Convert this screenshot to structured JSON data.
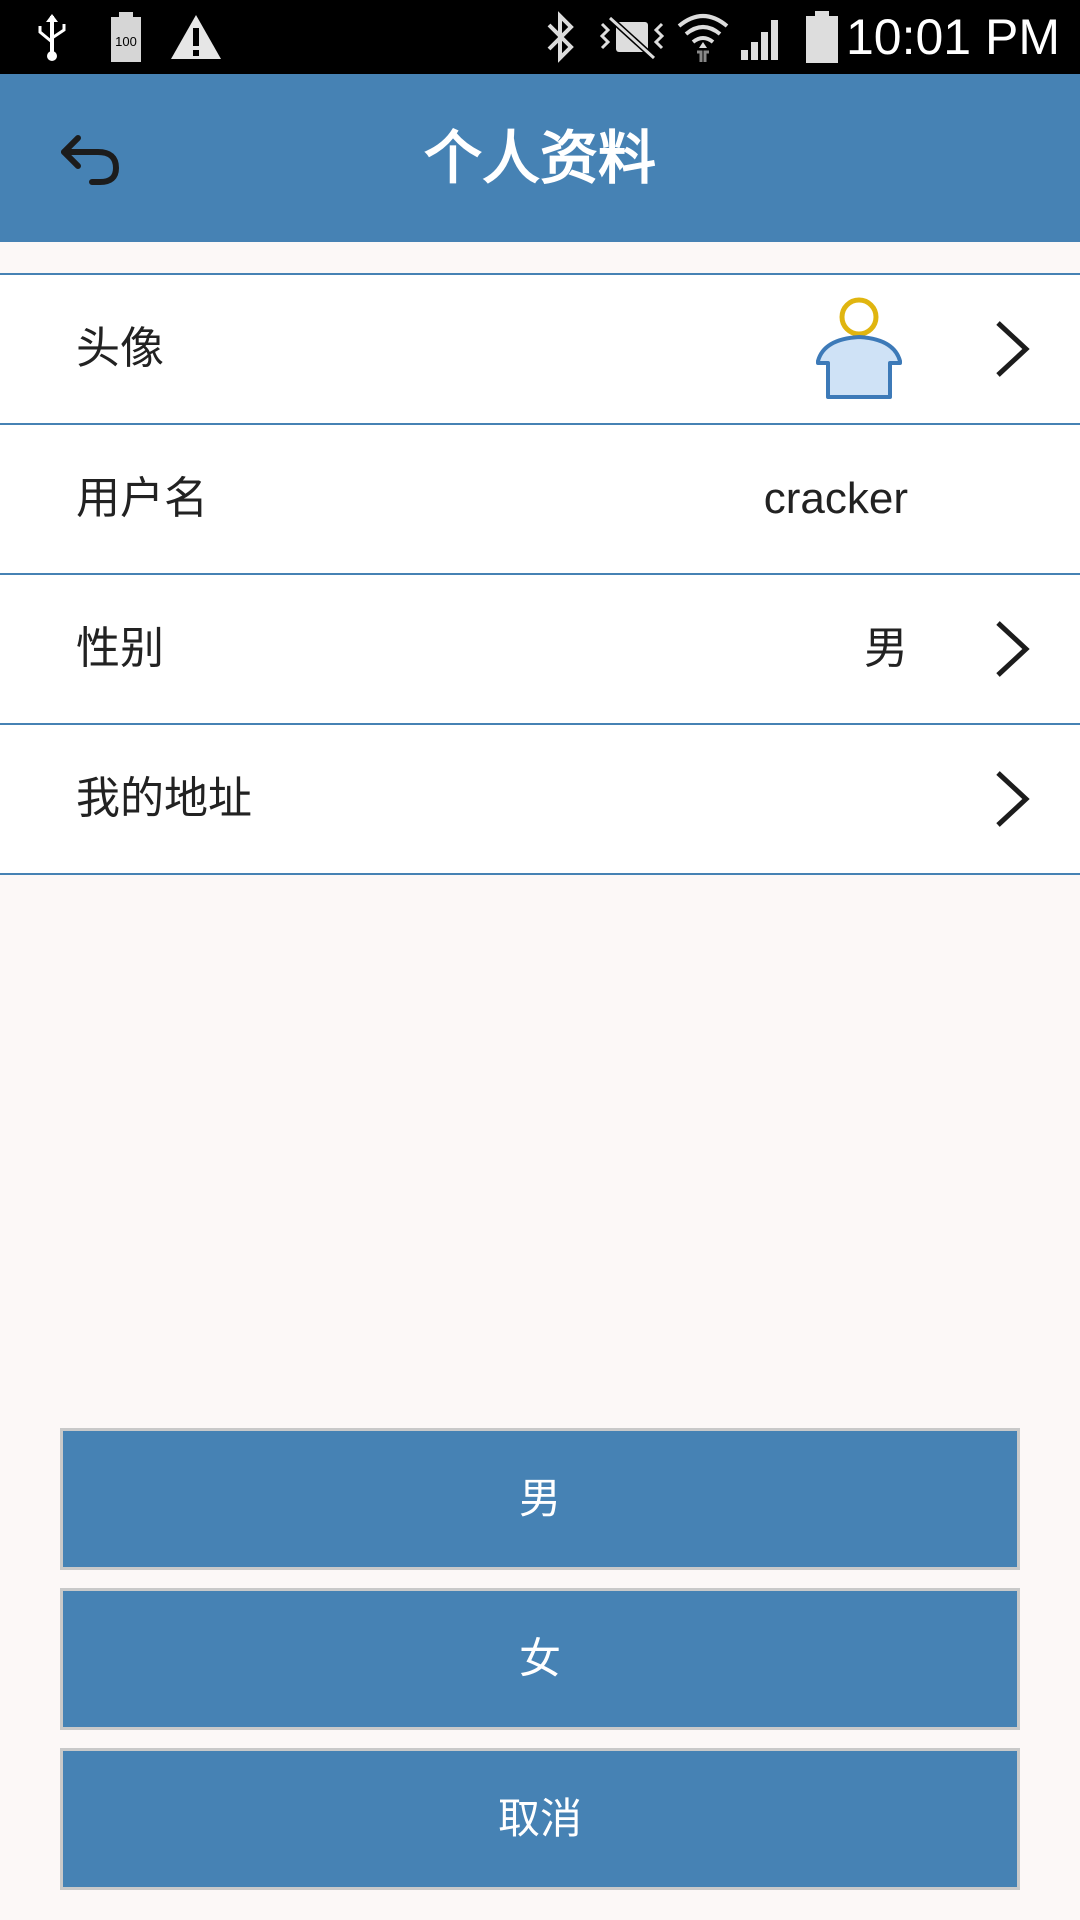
{
  "status_bar": {
    "time": "10:01 PM",
    "battery_level_label": "100",
    "icons": [
      "usb-icon",
      "battery-icon",
      "warning-icon",
      "bluetooth-icon",
      "mute-icon",
      "wifi-icon",
      "signal-icon",
      "battery-full-icon"
    ]
  },
  "app_bar": {
    "title": "个人资料",
    "back_icon": "back-arrow-icon"
  },
  "profile": {
    "rows": [
      {
        "label": "头像",
        "value": "",
        "has_chevron": true,
        "has_avatar": true
      },
      {
        "label": "用户名",
        "value": "cracker",
        "has_chevron": false
      },
      {
        "label": "性别",
        "value": "男",
        "has_chevron": true
      },
      {
        "label": "我的地址",
        "value": "",
        "has_chevron": true
      }
    ]
  },
  "gender_sheet": {
    "options": [
      {
        "label": "男"
      },
      {
        "label": "女"
      },
      {
        "label": "取消"
      }
    ]
  },
  "colors": {
    "primary": "#4682b4",
    "background": "#fcf8f7",
    "avatar_head": "#e0b510",
    "avatar_body": "#cfe2f6"
  }
}
